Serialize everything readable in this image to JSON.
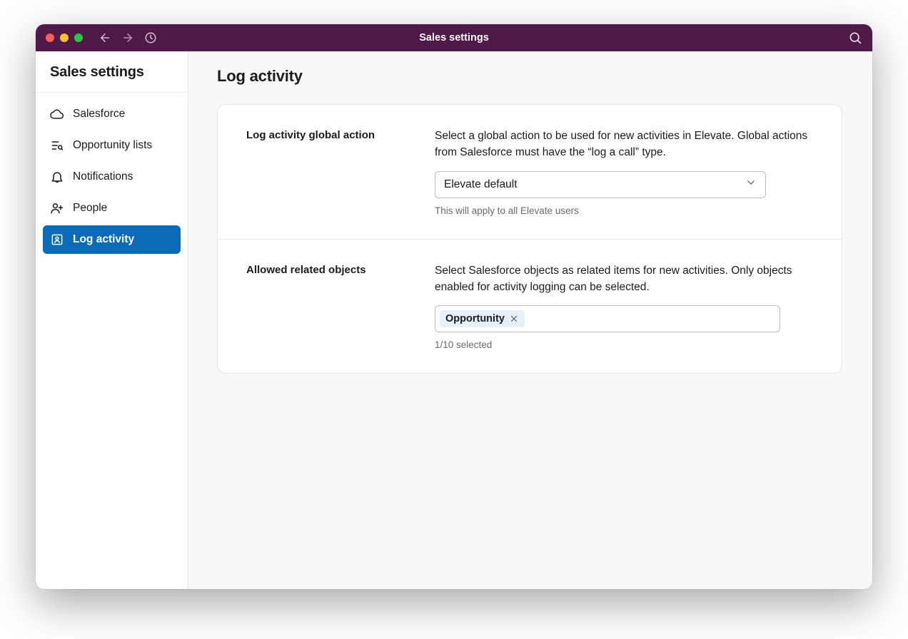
{
  "titlebar": {
    "title": "Sales settings"
  },
  "sidebar": {
    "title": "Sales settings",
    "items": [
      {
        "label": "Salesforce"
      },
      {
        "label": "Opportunity lists"
      },
      {
        "label": "Notifications"
      },
      {
        "label": "People"
      },
      {
        "label": "Log activity"
      }
    ]
  },
  "page": {
    "title": "Log activity"
  },
  "global_action": {
    "label": "Log activity global action",
    "description": "Select a global action to be used for new activities in Elevate. Global actions from Salesforce must have the “log a call” type.",
    "select_value": "Elevate default",
    "helper": "This will apply to all Elevate users"
  },
  "related_objects": {
    "label": "Allowed related objects",
    "description": "Select Salesforce objects as related items for new activities. Only objects enabled for activity logging can be selected.",
    "tags": [
      {
        "label": "Opportunity"
      }
    ],
    "helper": "1/10 selected"
  }
}
